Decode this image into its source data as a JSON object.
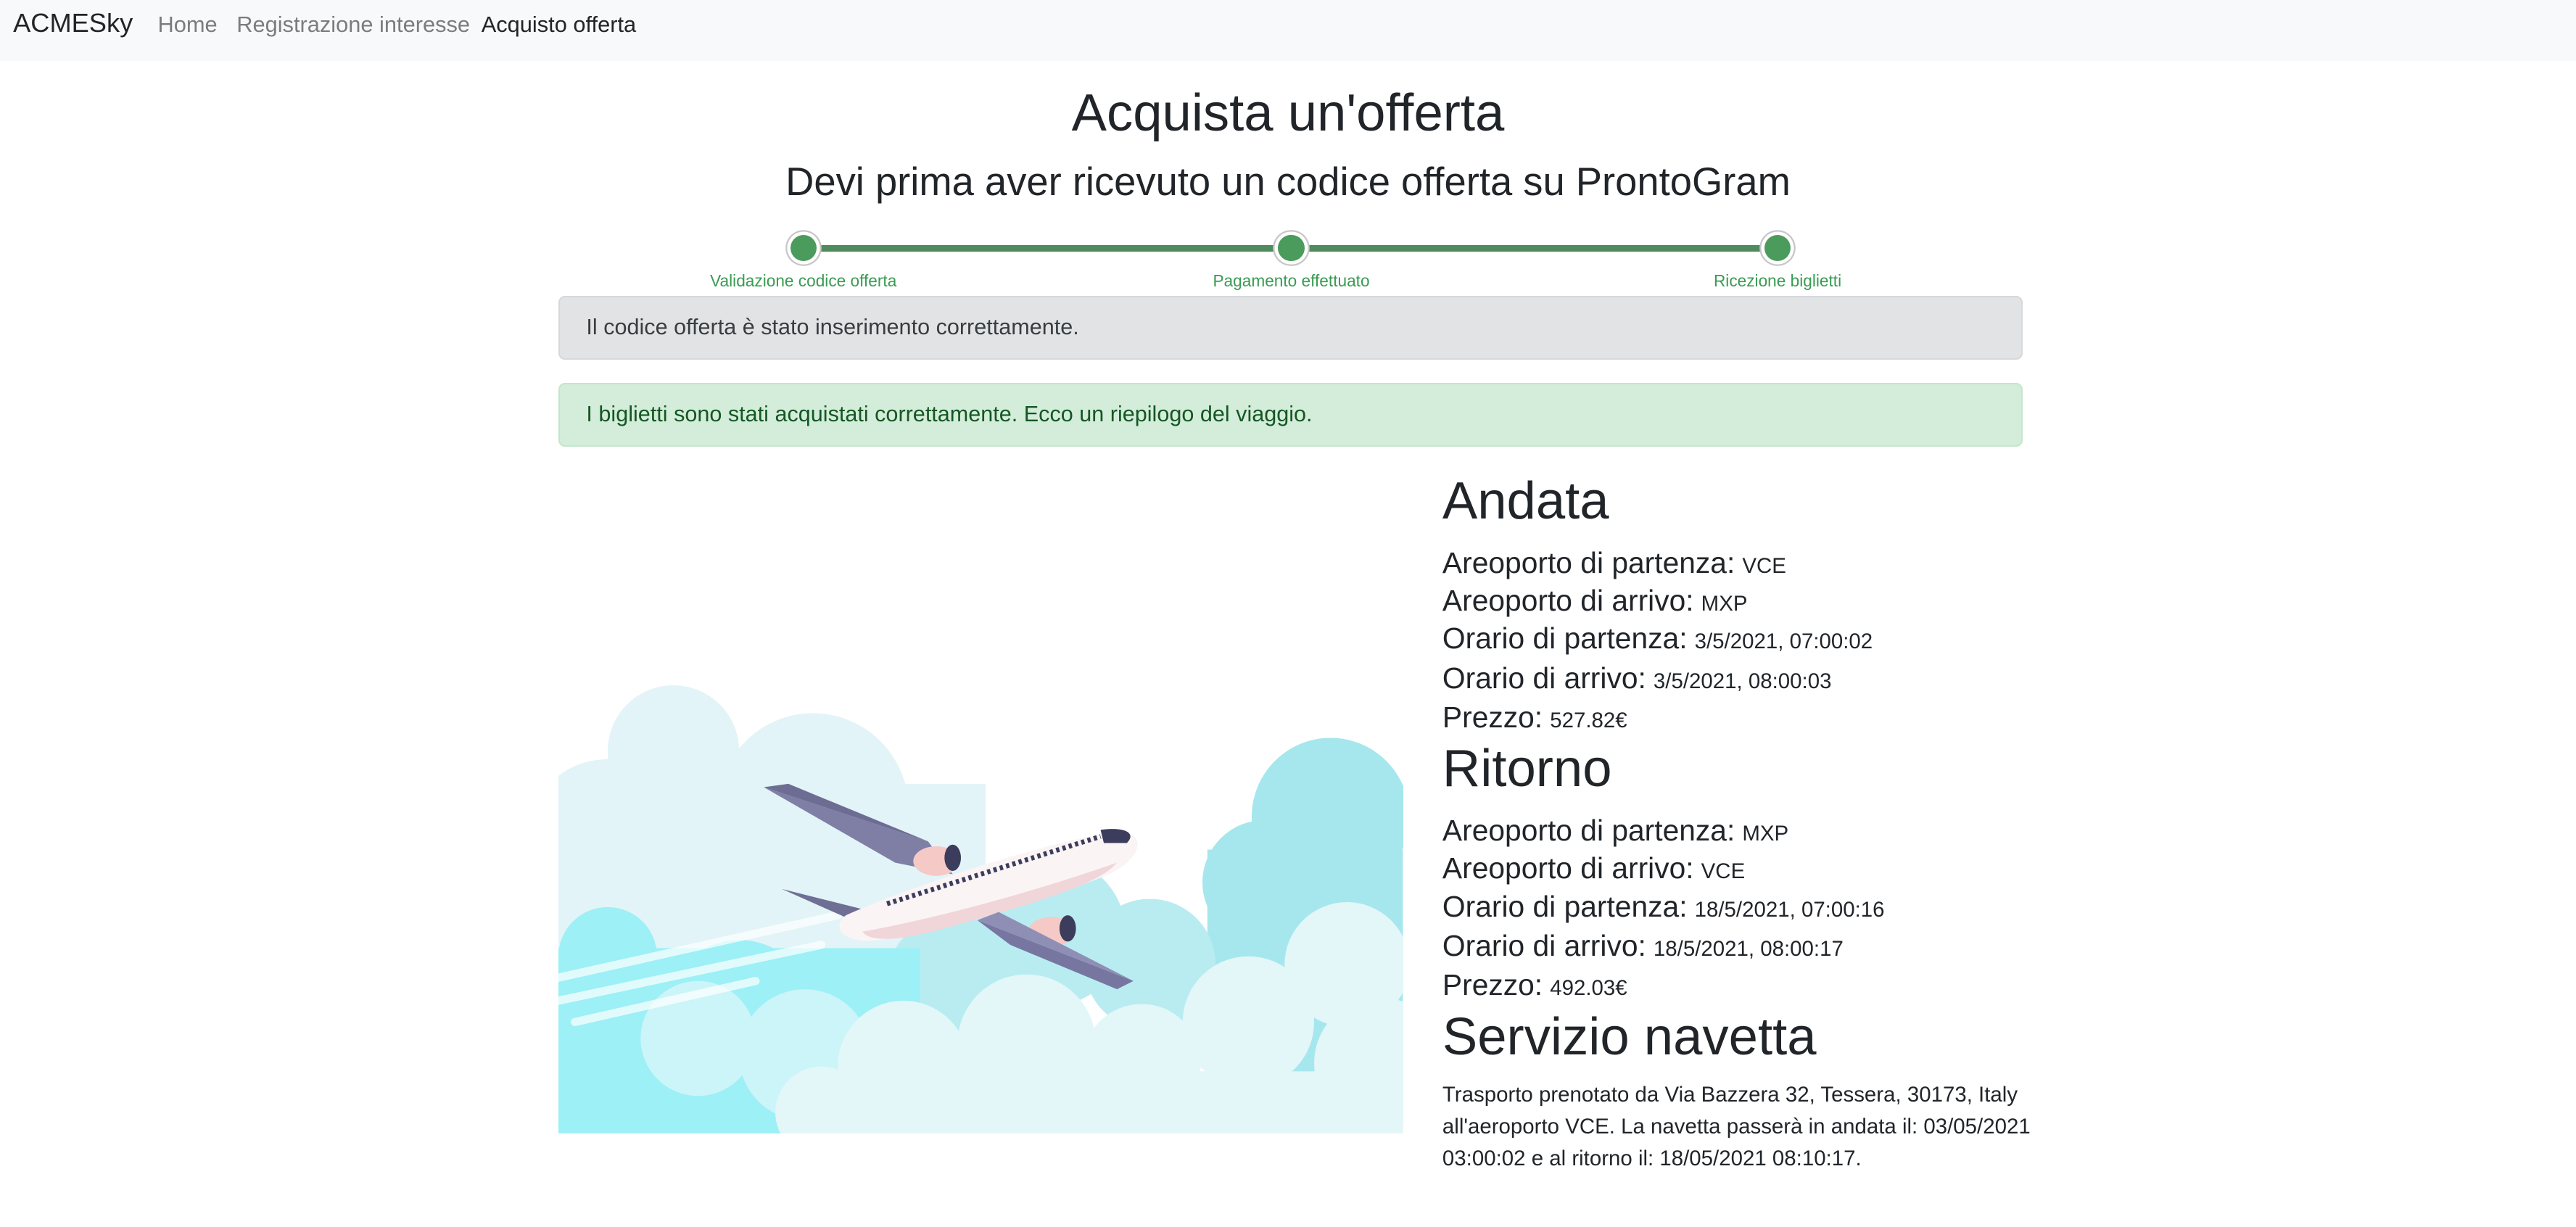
{
  "navbar": {
    "brand": "ACMESky",
    "links": [
      {
        "label": "Home"
      },
      {
        "label": "Registrazione interesse"
      },
      {
        "label": "Acquisto offerta"
      }
    ]
  },
  "page": {
    "title": "Acquista un'offerta",
    "subtitle": "Devi prima aver ricevuto un codice offerta su ProntoGram"
  },
  "steps": [
    {
      "label": "Validazione codice offerta"
    },
    {
      "label": "Pagamento effettuato"
    },
    {
      "label": "Ricezione biglietti"
    }
  ],
  "alerts": {
    "code_ok": "Il codice offerta è stato inserimento correttamente.",
    "tickets_ok": "I biglietti sono stati acquistati correttamente. Ecco un riepilogo del viaggio."
  },
  "andata": {
    "heading": "Andata",
    "rows": [
      {
        "k": "Areoporto di partenza:",
        "v": "VCE"
      },
      {
        "k": "Areoporto di arrivo:",
        "v": "MXP"
      },
      {
        "k": "Orario di partenza:",
        "v": "3/5/2021, 07:00:02"
      },
      {
        "k": "Orario di arrivo:",
        "v": "3/5/2021, 08:00:03"
      },
      {
        "k": "Prezzo:",
        "v": "527.82€"
      }
    ]
  },
  "ritorno": {
    "heading": "Ritorno",
    "rows": [
      {
        "k": "Areoporto di partenza:",
        "v": "MXP"
      },
      {
        "k": "Areoporto di arrivo:",
        "v": "VCE"
      },
      {
        "k": "Orario di partenza:",
        "v": "18/5/2021, 07:00:16"
      },
      {
        "k": "Orario di arrivo:",
        "v": "18/5/2021, 08:00:17"
      },
      {
        "k": "Prezzo:",
        "v": "492.03€"
      }
    ]
  },
  "navetta": {
    "heading": "Servizio navetta",
    "text": "Trasporto prenotato da Via Bazzera 32, Tessera, 30173, Italy all'aeroporto VCE. La navetta passerà in andata il: 03/05/2021 03:00:02 e al ritorno il: 18/05/2021 08:10:17."
  }
}
